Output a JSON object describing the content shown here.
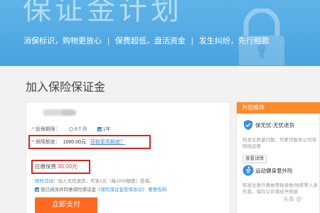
{
  "hero": {
    "title": "保证金计划",
    "subtitles": [
      "消保标识，购物更放心",
      "保费超低，盘活资金",
      "发生纠纷，先行赔款"
    ],
    "separator": "|"
  },
  "section": {
    "title": "加入保险保证金"
  },
  "form": {
    "period_label": "投保期限：",
    "period_options": [
      "6个月",
      "1年"
    ],
    "period_selected": "1年",
    "amount_label": "保障额度：",
    "amount_value": "1000.00元",
    "amount_link": "获取更高额度？",
    "fee_label": "应缴保费",
    "fee_value": "30.00元",
    "promo_label": "限时活动",
    "promo_text": "：加入无忧退货，可享1元（每1000额度）投保。",
    "agree_prefix": "我已阅读并同意保险保证金",
    "agree_link": "《保险保证金投保协议》",
    "agree_suffix": "要要告知",
    "submit_label": "立即支付"
  },
  "sidebar": {
    "header": "为您推荐",
    "items": [
      {
        "title": "保无忧-无忧退货",
        "desc": "知发生质量问题、可更货服务公司将赔偿运费",
        "button": "查看详情",
        "icon": "shield-check-icon"
      },
      {
        "title": "运动健身意外险",
        "desc": "知发生意外事故等致身故/残疾等人身伤害，保险公司将给予赔偿",
        "button": "查看详情",
        "icon": "runner-icon"
      }
    ]
  },
  "watermark": "头条 @",
  "colors": {
    "hero": "#4aa3df",
    "accent_blue": "#3b8ee0",
    "pay_orange": "#ff6a1f",
    "sidebar_header": "#ff8a2a",
    "highlight_red": "#e02020",
    "fee_red": "#e4393c"
  }
}
